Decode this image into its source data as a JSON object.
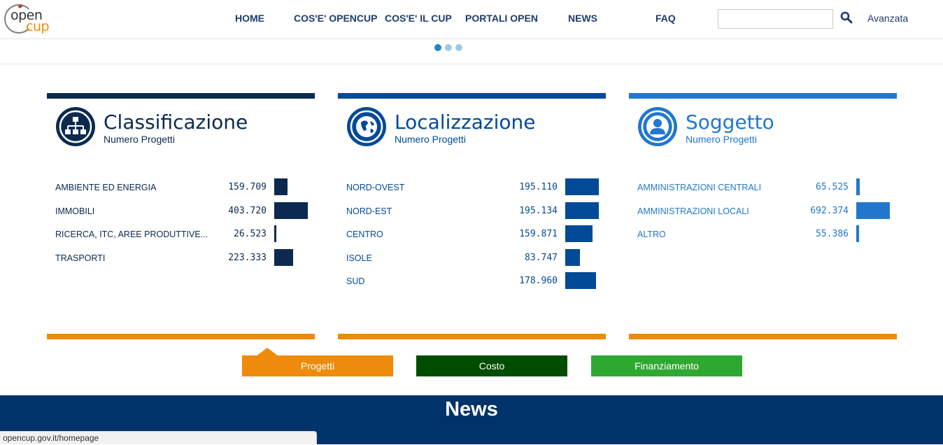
{
  "logo": {
    "part1": "open",
    "part2": "cup"
  },
  "nav": {
    "items": [
      {
        "label": "HOME"
      },
      {
        "label": "COS'E' OPENCUP"
      },
      {
        "label": "COS'E' IL CUP"
      },
      {
        "label": "PORTALI OPEN"
      },
      {
        "label": "NEWS"
      },
      {
        "label": "FAQ"
      }
    ],
    "search_value": "",
    "search_icon": "search-icon",
    "advanced_label": "Avanzata"
  },
  "carousel": {
    "count": 3,
    "active": 0
  },
  "colors": {
    "dark_navy": "#0c2a50",
    "medium_blue": "#004a98",
    "light_blue": "#2277cc",
    "orange": "#ef8b0c",
    "dark_green": "#004d00",
    "green": "#2fa832",
    "news_bg": "#003369"
  },
  "panels": [
    {
      "title": "Classificazione",
      "subtitle": "Numero Progetti",
      "icon": "hierarchy-icon",
      "rows": [
        {
          "label": "AMBIENTE ED ENERGIA",
          "value": "159.709",
          "num": 159709
        },
        {
          "label": "IMMOBILI",
          "value": "403.720",
          "num": 403720
        },
        {
          "label": "RICERCA, ITC, AREE PRODUTTIVE...",
          "value": "26.523",
          "num": 26523
        },
        {
          "label": "TRASPORTI",
          "value": "223.333",
          "num": 223333
        }
      ]
    },
    {
      "title": "Localizzazione",
      "subtitle": "Numero Progetti",
      "icon": "globe-icon",
      "rows": [
        {
          "label": "NORD-OVEST",
          "value": "195.110",
          "num": 195110
        },
        {
          "label": "NORD-EST",
          "value": "195.134",
          "num": 195134
        },
        {
          "label": "CENTRO",
          "value": "159.871",
          "num": 159871
        },
        {
          "label": "ISOLE",
          "value": "83.747",
          "num": 83747
        },
        {
          "label": "SUD",
          "value": "178.960",
          "num": 178960
        }
      ]
    },
    {
      "title": "Soggetto",
      "subtitle": "Numero Progetti",
      "icon": "user-icon",
      "rows": [
        {
          "label": "AMMINISTRAZIONI CENTRALI",
          "value": "65.525",
          "num": 65525
        },
        {
          "label": "AMMINISTRAZIONI LOCALI",
          "value": "692.374",
          "num": 692374
        },
        {
          "label": "ALTRO",
          "value": "55.386",
          "num": 55386
        }
      ]
    }
  ],
  "tabs": [
    {
      "label": "Progetti",
      "active": true
    },
    {
      "label": "Costo",
      "active": false
    },
    {
      "label": "Finanziamento",
      "active": false
    }
  ],
  "news": {
    "heading": "News"
  },
  "status": {
    "url": "opencup.gov.it/homepage"
  }
}
